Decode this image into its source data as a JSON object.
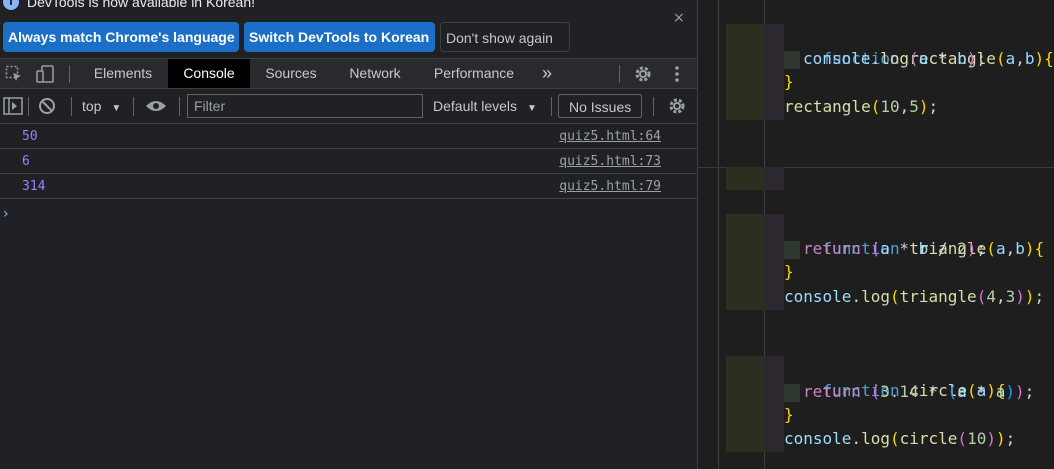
{
  "infobar": {
    "message": "DevTools is now available in Korean!",
    "buttons": {
      "match_language": "Always match Chrome's language",
      "switch_korean": "Switch DevTools to Korean",
      "dont_show": "Don't show again"
    },
    "close_glyph": "×"
  },
  "tabs": [
    "Elements",
    "Console",
    "Sources",
    "Network",
    "Performance"
  ],
  "active_tab": "Console",
  "more_tabs_glyph": "»",
  "console_toolbar": {
    "context": "top",
    "filter_placeholder": "Filter",
    "levels": "Default levels",
    "issues": "No Issues"
  },
  "messages": [
    {
      "value": "50",
      "source": "quiz5.html:64"
    },
    {
      "value": "6",
      "source": "quiz5.html:73"
    },
    {
      "value": "314",
      "source": "quiz5.html:79"
    }
  ],
  "prompt_glyph": "›",
  "colors": {
    "accent_button": "#1b6fc7",
    "console_number": "#9980ff",
    "keyword": "#569cd6",
    "function_name": "#dcdcaa",
    "parameter": "#9cdcfe",
    "number_literal": "#b5cea8",
    "control_keyword": "#c586c0"
  },
  "code_blocks": [
    {
      "name": "rectangle",
      "lines": [
        "function rectangle(a,b){",
        "  console.log(a * b);",
        "}",
        "rectangle(10,5);"
      ]
    },
    {
      "name": "triangle",
      "lines": [
        "function triangle(a,b){",
        "  return (a * b / 2);",
        "}",
        "console.log(triangle(4,3));"
      ]
    },
    {
      "name": "circle",
      "lines": [
        "function circle(a){",
        "  return (3.14 * (a * a));",
        "}",
        "console.log(circle(10));"
      ]
    }
  ]
}
